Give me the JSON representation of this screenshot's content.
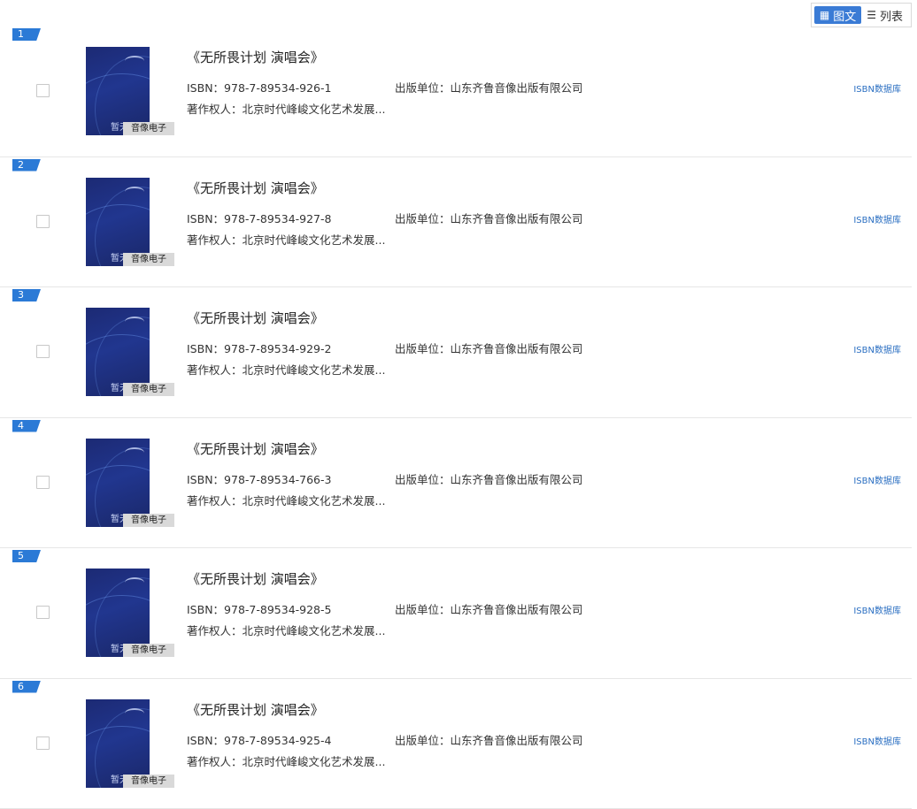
{
  "view_toggle": {
    "graphic_label": "图文",
    "list_label": "列表"
  },
  "items": [
    {
      "index": "1",
      "title": "《无所畏计划 演唱会》",
      "isbn": "ISBN：978-7-89534-926-1",
      "publisher": "出版单位：山东齐鲁音像出版有限公司",
      "copyright": "著作权人：北京时代峰峻文化艺术发展...",
      "tag": "音像电子",
      "cover_text": "暂无封面",
      "db_link": "ISBN数据库"
    },
    {
      "index": "2",
      "title": "《无所畏计划 演唱会》",
      "isbn": "ISBN：978-7-89534-927-8",
      "publisher": "出版单位：山东齐鲁音像出版有限公司",
      "copyright": "著作权人：北京时代峰峻文化艺术发展...",
      "tag": "音像电子",
      "cover_text": "暂无封面",
      "db_link": "ISBN数据库"
    },
    {
      "index": "3",
      "title": "《无所畏计划 演唱会》",
      "isbn": "ISBN：978-7-89534-929-2",
      "publisher": "出版单位：山东齐鲁音像出版有限公司",
      "copyright": "著作权人：北京时代峰峻文化艺术发展...",
      "tag": "音像电子",
      "cover_text": "暂无封面",
      "db_link": "ISBN数据库"
    },
    {
      "index": "4",
      "title": "《无所畏计划 演唱会》",
      "isbn": "ISBN：978-7-89534-766-3",
      "publisher": "出版单位：山东齐鲁音像出版有限公司",
      "copyright": "著作权人：北京时代峰峻文化艺术发展...",
      "tag": "音像电子",
      "cover_text": "暂无封面",
      "db_link": "ISBN数据库"
    },
    {
      "index": "5",
      "title": "《无所畏计划 演唱会》",
      "isbn": "ISBN：978-7-89534-928-5",
      "publisher": "出版单位：山东齐鲁音像出版有限公司",
      "copyright": "著作权人：北京时代峰峻文化艺术发展...",
      "tag": "音像电子",
      "cover_text": "暂无封面",
      "db_link": "ISBN数据库"
    },
    {
      "index": "6",
      "title": "《无所畏计划 演唱会》",
      "isbn": "ISBN：978-7-89534-925-4",
      "publisher": "出版单位：山东齐鲁音像出版有限公司",
      "copyright": "著作权人：北京时代峰峻文化艺术发展...",
      "tag": "音像电子",
      "cover_text": "暂无封面",
      "db_link": "ISBN数据库"
    }
  ],
  "colors": {
    "accent": "#2b7ad6",
    "link": "#2b6fc2",
    "tag_bg": "#d9d9d9",
    "cover": "#1c2a74"
  }
}
